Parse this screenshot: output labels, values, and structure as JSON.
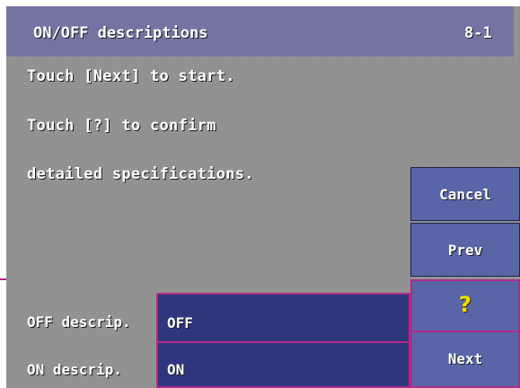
{
  "header": {
    "title": "ON/OFF descriptions",
    "page_number": "8-1"
  },
  "messages": [
    "Touch [Next] to start.",
    "Touch [?] to confirm",
    "detailed specifications."
  ],
  "buttons": {
    "cancel": "Cancel",
    "prev": "Prev",
    "help": "?",
    "next": "Next"
  },
  "fields": {
    "off": {
      "label": "OFF descrip.",
      "value": "OFF"
    },
    "on": {
      "label": "ON descrip.",
      "value": "ON"
    }
  },
  "colors": {
    "panel": "#808080",
    "titlebar": "#5e5e8c",
    "button": "#3f4f92",
    "field": "#1f2460",
    "accent_border": "#b02a8a",
    "help_glyph": "#f4e000"
  }
}
